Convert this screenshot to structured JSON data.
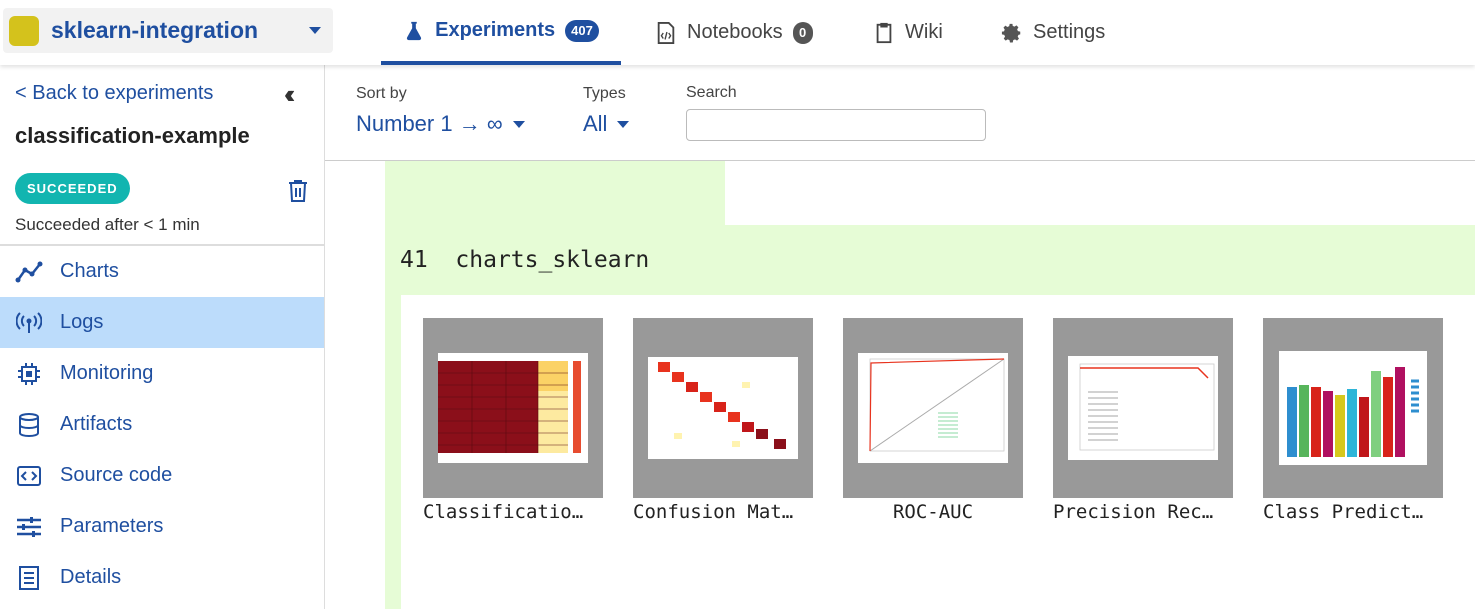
{
  "project": {
    "name": "sklearn-integration",
    "color": "#d4c21c"
  },
  "tabs": [
    {
      "label": "Experiments",
      "count": "407",
      "icon": "flask-icon"
    },
    {
      "label": "Notebooks",
      "count": "0",
      "icon": "notebook-icon"
    },
    {
      "label": "Wiki",
      "icon": "clipboard-icon"
    },
    {
      "label": "Settings",
      "icon": "gear-icon"
    }
  ],
  "sidebar": {
    "back_label": "< Back to experiments",
    "experiment_title": "classification-example",
    "status": "SUCCEEDED",
    "status_detail": "Succeeded after < 1 min",
    "items": [
      {
        "label": "Charts",
        "icon": "chart-line-icon"
      },
      {
        "label": "Logs",
        "icon": "antenna-icon"
      },
      {
        "label": "Monitoring",
        "icon": "chip-icon"
      },
      {
        "label": "Artifacts",
        "icon": "database-icon"
      },
      {
        "label": "Source code",
        "icon": "code-file-icon"
      },
      {
        "label": "Parameters",
        "icon": "sliders-icon"
      },
      {
        "label": "Details",
        "icon": "details-icon"
      }
    ]
  },
  "filters": {
    "sort_label": "Sort by",
    "sort_value": "Number 1 → ∞",
    "types_label": "Types",
    "types_value": "All",
    "search_label": "Search",
    "search_value": ""
  },
  "log": {
    "number": "41",
    "name": "charts_sklearn",
    "images": [
      {
        "caption": "Classificatio…"
      },
      {
        "caption": "Confusion Mat…"
      },
      {
        "caption": "ROC-AUC"
      },
      {
        "caption": "Precision Rec…"
      },
      {
        "caption": "Class Predict…"
      }
    ]
  },
  "colors": {
    "accent": "#1f4fa0",
    "status": "#12b5b0",
    "active_nav": "#bcdcfb",
    "log_highlight": "#e6fcd6"
  }
}
